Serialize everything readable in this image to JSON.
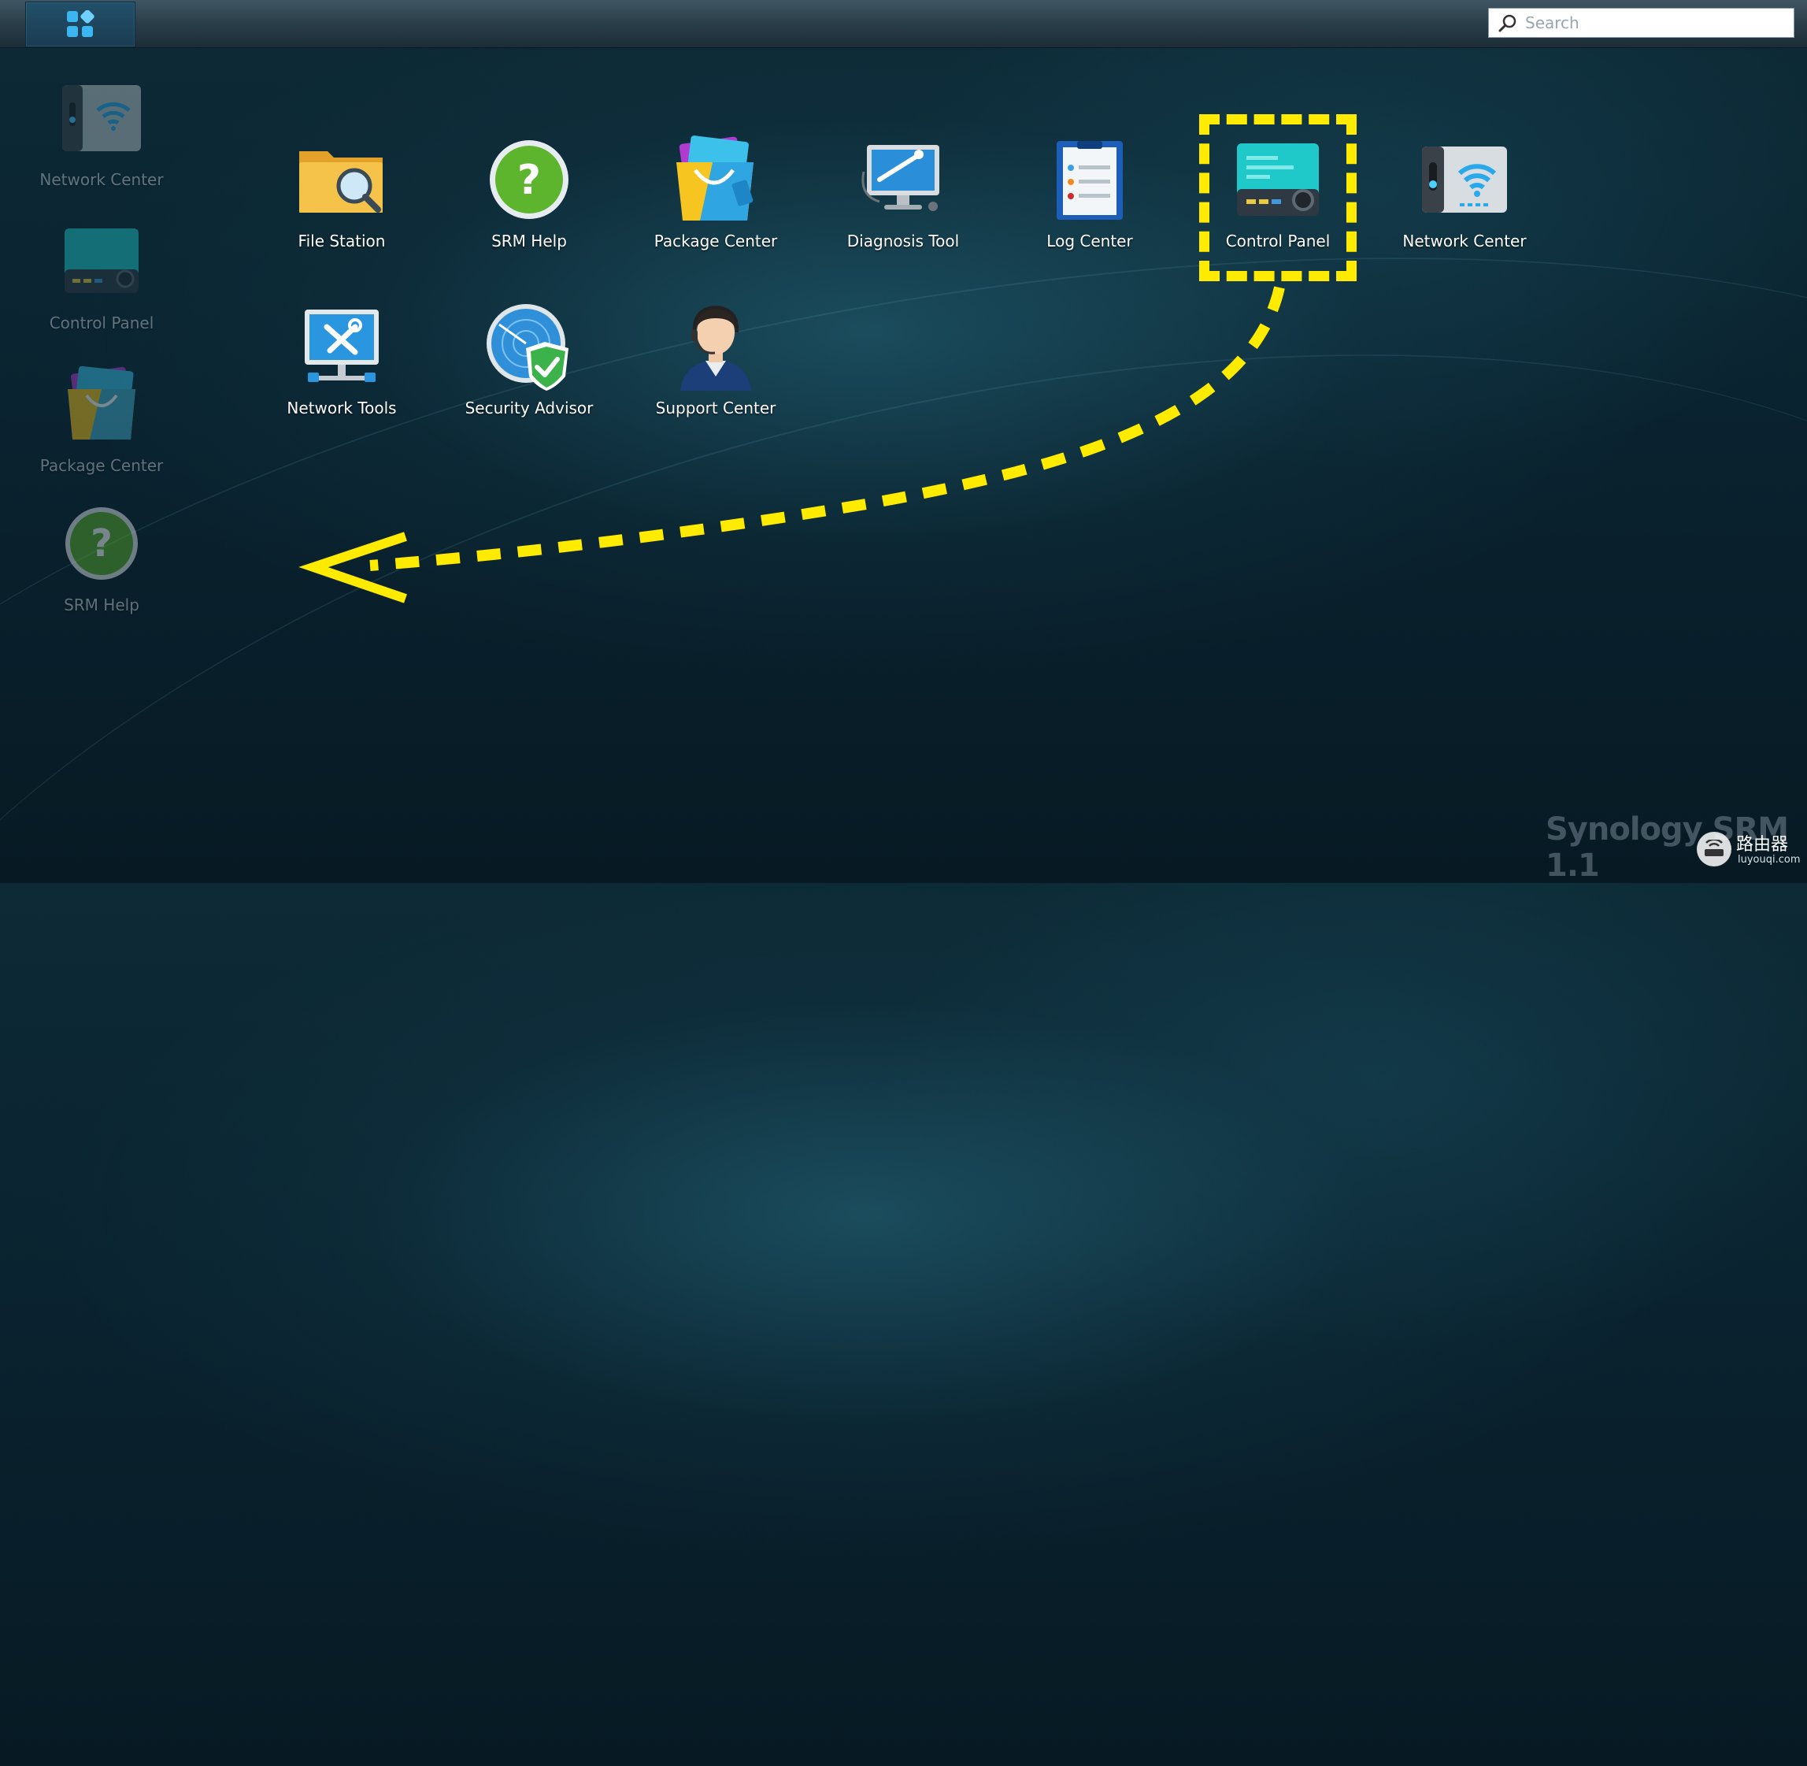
{
  "taskbar": {
    "main_menu_icon": "grid-icon",
    "search": {
      "placeholder": "Search",
      "value": ""
    }
  },
  "desktop_shortcuts": [
    {
      "label": "Network Center",
      "icon": "network-center-icon"
    },
    {
      "label": "Control Panel",
      "icon": "control-panel-icon"
    },
    {
      "label": "Package Center",
      "icon": "package-center-icon"
    },
    {
      "label": "SRM Help",
      "icon": "help-icon"
    }
  ],
  "main_menu": {
    "apps": [
      {
        "label": "File Station",
        "icon": "folder-icon"
      },
      {
        "label": "SRM Help",
        "icon": "help-icon"
      },
      {
        "label": "Package Center",
        "icon": "package-center-icon"
      },
      {
        "label": "Diagnosis Tool",
        "icon": "diagnosis-tool-icon"
      },
      {
        "label": "Log Center",
        "icon": "log-center-icon"
      },
      {
        "label": "Control Panel",
        "icon": "control-panel-icon"
      },
      {
        "label": "Network Center",
        "icon": "network-center-icon"
      },
      {
        "label": "Network Tools",
        "icon": "network-tools-icon"
      },
      {
        "label": "Security Advisor",
        "icon": "security-advisor-icon"
      },
      {
        "label": "Support Center",
        "icon": "support-center-icon"
      }
    ]
  },
  "annotation": {
    "highlight_color": "#ffeb00",
    "highlighted_app": "Control Panel"
  },
  "branding": {
    "logo_text": "Synology SRM 1.1"
  },
  "watermark": {
    "site_name": "路由器",
    "url": "luyouqi.com"
  }
}
